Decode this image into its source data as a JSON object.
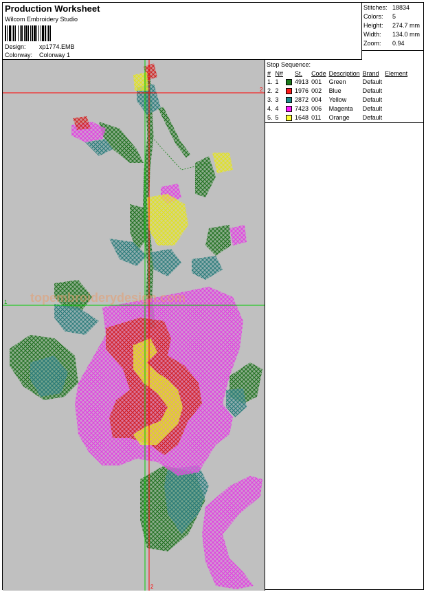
{
  "worksheet": {
    "title": "Production Worksheet",
    "software": "Wilcom Embroidery Studio",
    "design_label": "Design:",
    "design_value": "xp1774.EMB",
    "colorway_label": "Colorway:",
    "colorway_value": "Colorway 1"
  },
  "stats": [
    {
      "label": "Stitches:",
      "value": "18834"
    },
    {
      "label": "Colors:",
      "value": "5"
    },
    {
      "label": "Height:",
      "value": "274.7 mm"
    },
    {
      "label": "Width:",
      "value": "134.0 mm"
    },
    {
      "label": "Zoom:",
      "value": "0.94"
    }
  ],
  "stop_sequence": {
    "title": "Stop Sequence:",
    "headers": [
      "#",
      "N#",
      "St.",
      "Code",
      "Description",
      "Brand",
      "Element"
    ],
    "rows": [
      {
        "num": "1.",
        "n": "1",
        "color": "#1c7a1c",
        "st": "4913",
        "code": "001",
        "description": "Green",
        "brand": "Default",
        "element": ""
      },
      {
        "num": "2.",
        "n": "2",
        "color": "#ff1a1a",
        "st": "1976",
        "code": "002",
        "description": "Blue",
        "brand": "Default",
        "element": ""
      },
      {
        "num": "3.",
        "n": "3",
        "color": "#1a8a8a",
        "st": "2872",
        "code": "004",
        "description": "Yellow",
        "brand": "Default",
        "element": ""
      },
      {
        "num": "4.",
        "n": "4",
        "color": "#ff1aff",
        "st": "7423",
        "code": "006",
        "description": "Magenta",
        "brand": "Default",
        "element": ""
      },
      {
        "num": "5.",
        "n": "5",
        "color": "#ffff33",
        "st": "1648",
        "code": "011",
        "description": "Orange",
        "brand": "Default",
        "element": ""
      }
    ]
  },
  "canvas": {
    "guide_labels": {
      "top_right": "2",
      "left": "1",
      "bottom": "2"
    },
    "watermark": "topembroiderydesign.com",
    "colors": {
      "green": "#2e8b2e",
      "teal": "#3a9090",
      "red": "#e83a3a",
      "magenta": "#e860e8",
      "yellow": "#eeee44",
      "guide_red": "#ff0000",
      "guide_green": "#00cc00",
      "background": "#c0c0c0"
    }
  }
}
